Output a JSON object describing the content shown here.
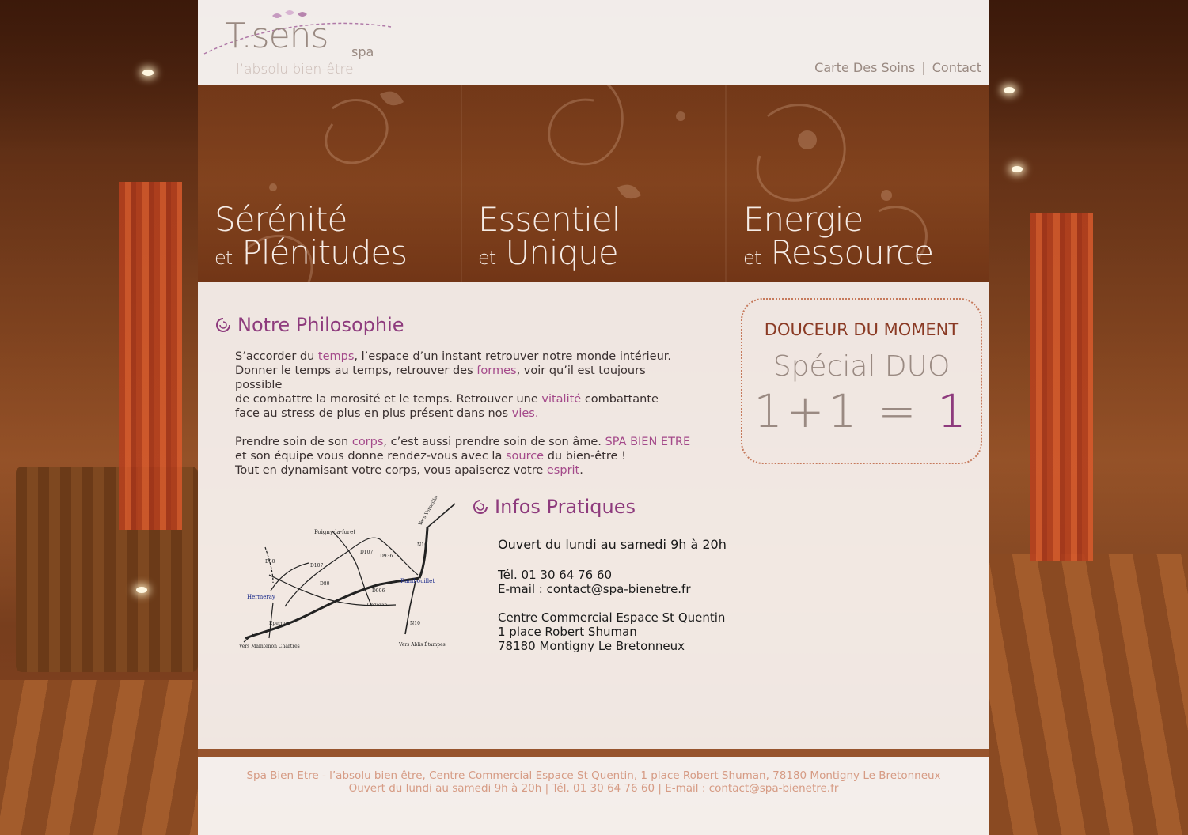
{
  "brand": {
    "logo_main": "T.sens",
    "logo_spa": "spa",
    "tagline": "l’absolu bien-être"
  },
  "nav": {
    "items": [
      {
        "label": "Carte Des Soins"
      },
      {
        "label": "Contact"
      }
    ],
    "separator": "|"
  },
  "hero": {
    "panels": [
      {
        "line1": "Sérénité",
        "et": "et",
        "line2": "Plénitudes"
      },
      {
        "line1": "Essentiel",
        "et": "et",
        "line2": "Unique"
      },
      {
        "line1": "Energie",
        "et": "et",
        "line2": "Ressource"
      }
    ]
  },
  "philosophy": {
    "title": "Notre Philosophie",
    "p1": {
      "s1": "S’accorder du ",
      "h1": "temps",
      "s2": ",  l’espace d’un instant retrouver notre monde intérieur.",
      "s3": "Donner le temps au temps, retrouver des ",
      "h2": "formes",
      "s4": ", voir qu’il est toujours possible",
      "s5": "de combattre la morosité et le temps. Retrouver une ",
      "h3": "vitalité",
      "s6": " combattante",
      "s7": "face au stress de plus en plus présent dans nos ",
      "h4": "vies."
    },
    "p2": {
      "s1": "Prendre soin de son ",
      "h1": "corps",
      "s2": ", c’est aussi prendre soin de son âme. ",
      "h2": "SPA BIEN ETRE",
      "s3": "et son équipe vous donne rendez-vous avec la ",
      "h3": "source",
      "s4": " du bien-être !",
      "s5": "Tout en dynamisant votre corps, vous apaiserez votre ",
      "h4": "esprit",
      "s6": "."
    }
  },
  "promo": {
    "heading": "DOUCEUR DU MOMENT",
    "special": "Spécial DUO",
    "equation_left": "1+1 =",
    "equation_right": "1"
  },
  "infos": {
    "title": "Infos Pratiques",
    "hours": "Ouvert du lundi au samedi 9h à 20h",
    "tel": "Tél. 01 30 64 76 60",
    "email": "E-mail : contact@spa-bienetre.fr",
    "address1": "Centre Commercial Espace St Quentin",
    "address2": "1 place Robert Shuman",
    "address3": "78180 Montigny Le Bretonneux"
  },
  "map": {
    "labels": {
      "poigny": "Poigny-la-foret",
      "versailles": "Vers Versailles Paris",
      "n10_top": "N10",
      "d107_a": "D107",
      "d936": "D936",
      "d80_a": "D80",
      "d107_b": "D107",
      "rambouillet": "Rambouillet",
      "d80_b": "D80",
      "d906": "D906",
      "hermeray": "Hermeray",
      "gazeran": "Gazeran",
      "epernon": "Epernon",
      "n10_bottom": "N10",
      "maintenon": "Vers Maintenon Chartres",
      "ablis": "Vers Ablis Étampes"
    }
  },
  "footer": {
    "line1": "Spa Bien Etre - l’absolu bien être, Centre Commercial Espace St Quentin, 1 place Robert Shuman, 78180 Montigny Le Bretonneux",
    "line2": "Ouvert du lundi au samedi 9h à 20h  |  Tél. 01 30 64 76 60  |  E-mail : contact@spa-bienetre.fr"
  },
  "colors": {
    "accent_purple": "#8e3b7d",
    "highlight": "#a44a8a",
    "promo_brown": "#8a3a24",
    "footer_text": "#d69b84"
  }
}
